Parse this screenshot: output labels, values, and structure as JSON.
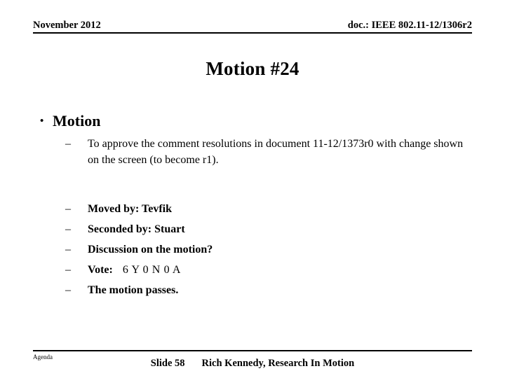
{
  "header": {
    "date": "November 2012",
    "doc": "doc.: IEEE 802.11-12/1306r2"
  },
  "title": "Motion #24",
  "body": {
    "bullet": {
      "marker": "•",
      "label": "Motion"
    },
    "sub_marker": "–",
    "items": [
      {
        "text": "To approve the comment resolutions in document 11-12/1373r0 with change shown on the screen (to become r1)."
      },
      {
        "text": "Moved by: Tevfik"
      },
      {
        "text": "Seconded by: Stuart"
      },
      {
        "text": "Discussion on the motion?"
      },
      {
        "label": "Vote:",
        "tally": "6 Y  0 N 0 A"
      },
      {
        "text": "The motion passes."
      }
    ]
  },
  "footer": {
    "agenda": "Agenda",
    "slide": "Slide 58",
    "author": "Rich Kennedy, Research In Motion"
  }
}
